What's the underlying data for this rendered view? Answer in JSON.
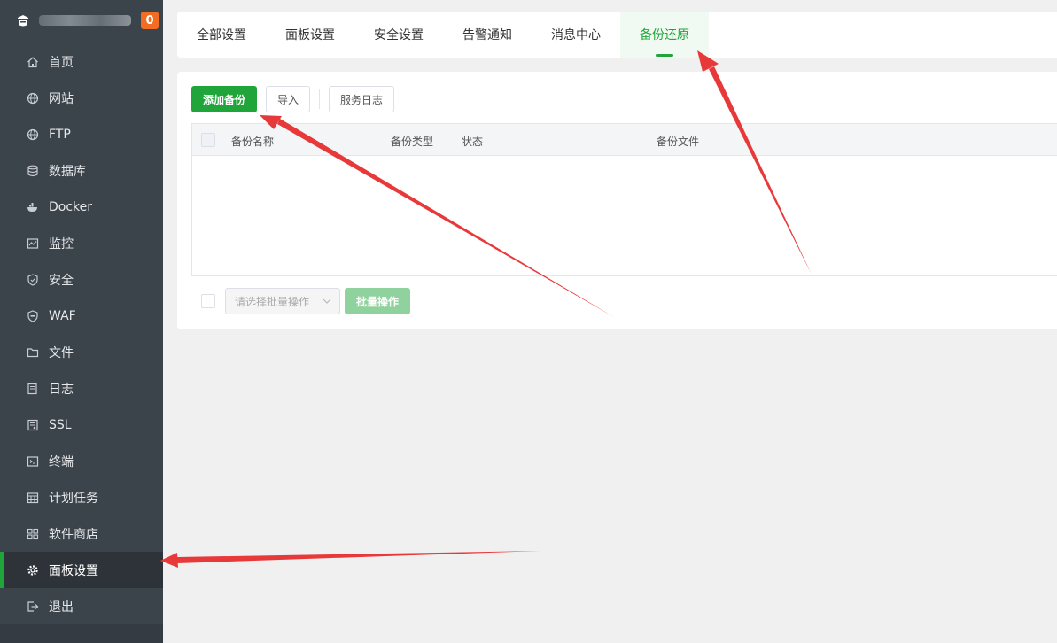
{
  "sidebar": {
    "badge": "0",
    "items": [
      {
        "label": "首页",
        "icon": "home-icon"
      },
      {
        "label": "网站",
        "icon": "globe-icon"
      },
      {
        "label": "FTP",
        "icon": "globe-icon"
      },
      {
        "label": "数据库",
        "icon": "database-icon"
      },
      {
        "label": "Docker",
        "icon": "docker-icon"
      },
      {
        "label": "监控",
        "icon": "monitor-icon"
      },
      {
        "label": "安全",
        "icon": "shield-icon"
      },
      {
        "label": "WAF",
        "icon": "waf-shield-icon"
      },
      {
        "label": "文件",
        "icon": "folder-icon"
      },
      {
        "label": "日志",
        "icon": "log-icon"
      },
      {
        "label": "SSL",
        "icon": "certificate-icon"
      },
      {
        "label": "终端",
        "icon": "terminal-icon"
      },
      {
        "label": "计划任务",
        "icon": "calendar-icon"
      },
      {
        "label": "软件商店",
        "icon": "grid-icon"
      },
      {
        "label": "面板设置",
        "icon": "gear-icon"
      },
      {
        "label": "退出",
        "icon": "logout-icon"
      }
    ],
    "active_index": 14
  },
  "tabs": [
    "全部设置",
    "面板设置",
    "安全设置",
    "告警通知",
    "消息中心",
    "备份还原"
  ],
  "active_tab": 5,
  "toolbar": {
    "add_backup": "添加备份",
    "import": "导入",
    "service_log": "服务日志"
  },
  "table": {
    "columns": [
      "备份名称",
      "备份类型",
      "状态",
      "备份文件"
    ],
    "rows": []
  },
  "footer": {
    "batch_placeholder": "请选择批量操作",
    "batch_button": "批量操作"
  },
  "colors": {
    "accent": "#20a53a",
    "sidebar_bg": "#3b434b",
    "badge": "#f26d21",
    "annotation_arrow": "#e8393a"
  }
}
